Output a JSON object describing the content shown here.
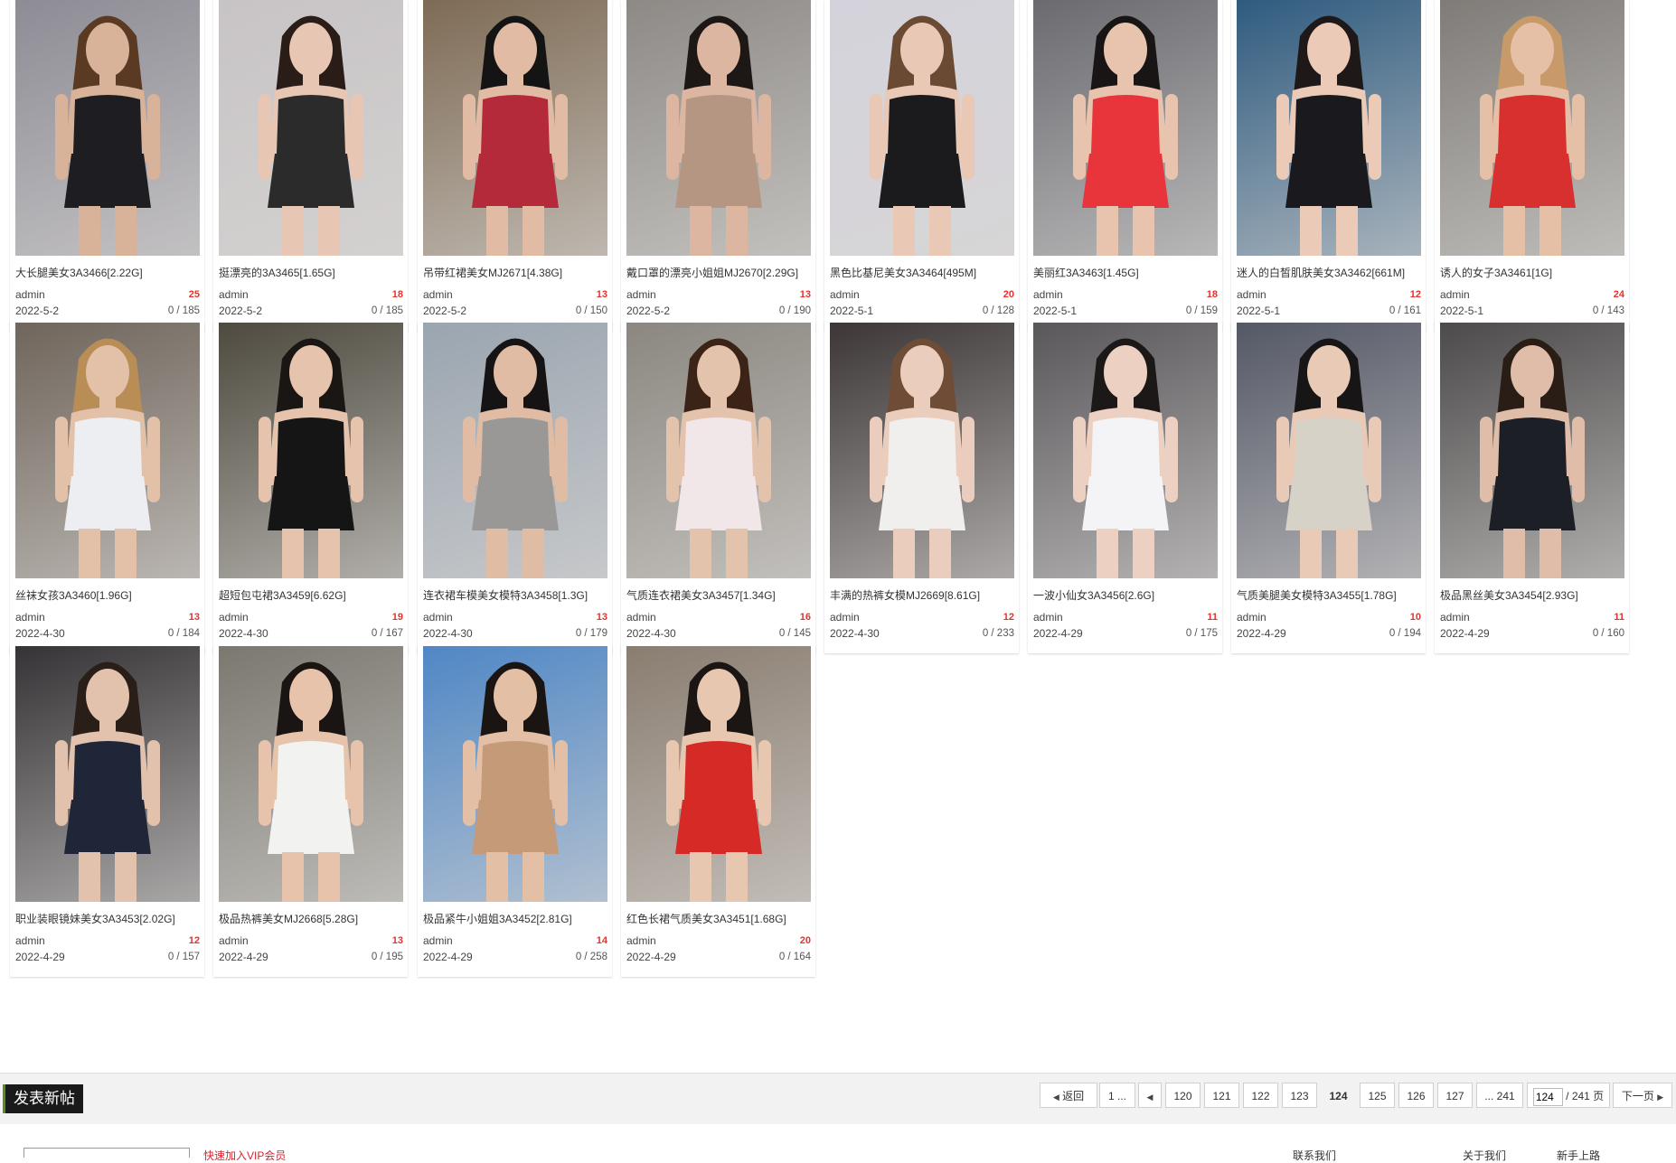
{
  "posts": [
    {
      "title": "大长腿美女3A3466[2.22G]",
      "author": "admin",
      "replies": "25",
      "date": "2022-5-2",
      "views": "0 / 185",
      "bg": "#8d8c95",
      "outfit": "#1e1e22",
      "skin": "#d9b29a",
      "hair": "#5a3a22"
    },
    {
      "title": "挺漂亮的3A3465[1.65G]",
      "author": "admin",
      "replies": "18",
      "date": "2022-5-2",
      "views": "0 / 185",
      "bg": "#c8c4c6",
      "outfit": "#2b2b2b",
      "skin": "#e7c6b3",
      "hair": "#2a1d18"
    },
    {
      "title": "吊带红裙美女MJ2671[4.38G]",
      "author": "admin",
      "replies": "13",
      "date": "2022-5-2",
      "views": "0 / 150",
      "bg": "#7e6b55",
      "outfit": "#b52a3a",
      "skin": "#e2bba4",
      "hair": "#141414"
    },
    {
      "title": "戴口罩的漂亮小姐姐MJ2670[2.29G]",
      "author": "admin",
      "replies": "13",
      "date": "2022-5-2",
      "views": "0 / 190",
      "bg": "#8d8a86",
      "outfit": "#b59683",
      "skin": "#dcb6a0",
      "hair": "#1d1715"
    },
    {
      "title": "黑色比基尼美女3A3464[495M]",
      "author": "admin",
      "replies": "20",
      "date": "2022-5-1",
      "views": "0 / 128",
      "bg": "#d4d3db",
      "outfit": "#1b1b1e",
      "skin": "#e9c8b6",
      "hair": "#6b4a33"
    },
    {
      "title": "美丽红3A3463[1.45G]",
      "author": "admin",
      "replies": "18",
      "date": "2022-5-1",
      "views": "0 / 159",
      "bg": "#6a6a70",
      "outfit": "#e8343b",
      "skin": "#e8c4ae",
      "hair": "#1a1515"
    },
    {
      "title": "迷人的白皙肌肤美女3A3462[661M]",
      "author": "admin",
      "replies": "12",
      "date": "2022-5-1",
      "views": "0 / 161",
      "bg": "#2f5b7f",
      "outfit": "#1a1a1e",
      "skin": "#ebcab8",
      "hair": "#1e1818"
    },
    {
      "title": "诱人的女子3A3461[1G]",
      "author": "admin",
      "replies": "24",
      "date": "2022-5-1",
      "views": "0 / 143",
      "bg": "#7f7c78",
      "outfit": "#d8302e",
      "skin": "#e5c0a6",
      "hair": "#c89a6a"
    },
    {
      "title": "丝袜女孩3A3460[1.96G]",
      "author": "admin",
      "replies": "13",
      "date": "2022-4-30",
      "views": "0 / 184",
      "bg": "#6f655b",
      "outfit": "#eceef2",
      "skin": "#e3c0a8",
      "hair": "#b98d56"
    },
    {
      "title": "超短包屯裙3A3459[6.62G]",
      "author": "admin",
      "replies": "19",
      "date": "2022-4-30",
      "views": "0 / 167",
      "bg": "#4e4a3f",
      "outfit": "#151515",
      "skin": "#e5c3ad",
      "hair": "#1a1614"
    },
    {
      "title": "连衣裙车模美女模特3A3458[1.3G]",
      "author": "admin",
      "replies": "13",
      "date": "2022-4-30",
      "views": "0 / 179",
      "bg": "#9aa5b0",
      "outfit": "#9a9896",
      "skin": "#e0bca5",
      "hair": "#151313"
    },
    {
      "title": "气质连衣裙美女3A3457[1.34G]",
      "author": "admin",
      "replies": "16",
      "date": "2022-4-30",
      "views": "0 / 145",
      "bg": "#8b8780",
      "outfit": "#f1e6e8",
      "skin": "#e4c3ad",
      "hair": "#3b2417"
    },
    {
      "title": "丰满的热裤女模MJ2669[8.61G]",
      "author": "admin",
      "replies": "12",
      "date": "2022-4-30",
      "views": "0 / 233",
      "bg": "#3c3636",
      "outfit": "#f0efee",
      "skin": "#ebcdbd",
      "hair": "#6f4c35"
    },
    {
      "title": "一波小仙女3A3456[2.6G]",
      "author": "admin",
      "replies": "11",
      "date": "2022-4-29",
      "views": "0 / 175",
      "bg": "#59575a",
      "outfit": "#f4f4f6",
      "skin": "#ecd0c1",
      "hair": "#1d1818"
    },
    {
      "title": "气质美腿美女模特3A3455[1.78G]",
      "author": "admin",
      "replies": "10",
      "date": "2022-4-29",
      "views": "0 / 194",
      "bg": "#545866",
      "outfit": "#d7d2c8",
      "skin": "#e9cab6",
      "hair": "#171515"
    },
    {
      "title": "极品黑丝美女3A3454[2.93G]",
      "author": "admin",
      "replies": "11",
      "date": "2022-4-29",
      "views": "0 / 160",
      "bg": "#4c4a4a",
      "outfit": "#1d1f26",
      "skin": "#dfbda8",
      "hair": "#2a1d16"
    },
    {
      "title": "职业装眼镜妹美女3A3453[2.02G]",
      "author": "admin",
      "replies": "12",
      "date": "2022-4-29",
      "views": "0 / 157",
      "bg": "#353335",
      "outfit": "#1f2638",
      "skin": "#e2c2ac",
      "hair": "#2a1e18"
    },
    {
      "title": "极品热裤美女MJ2668[5.28G]",
      "author": "admin",
      "replies": "13",
      "date": "2022-4-29",
      "views": "0 / 195",
      "bg": "#7b7870",
      "outfit": "#f2f2f0",
      "skin": "#e6c3aa",
      "hair": "#1a1512"
    },
    {
      "title": "极品紧牛小姐姐3A3452[2.81G]",
      "author": "admin",
      "replies": "14",
      "date": "2022-4-29",
      "views": "0 / 258",
      "bg": "#4f87c5",
      "outfit": "#c49a78",
      "skin": "#e3bfa6",
      "hair": "#1a1513"
    },
    {
      "title": "红色长裙气质美女3A3451[1.68G]",
      "author": "admin",
      "replies": "20",
      "date": "2022-4-29",
      "views": "0 / 164",
      "bg": "#8a7d70",
      "outfit": "#d52a25",
      "skin": "#e8c7b1",
      "hair": "#1b1614"
    }
  ],
  "new_post_label": "发表新帖",
  "pager": {
    "back": "返回",
    "first": "1 ...",
    "pages": [
      "120",
      "121",
      "122",
      "123",
      "124",
      "125",
      "126",
      "127"
    ],
    "current": "124",
    "last": "... 241",
    "input_value": "124",
    "total": "/ 241 页",
    "next": "下一页"
  },
  "footer": {
    "red_text": "快速加入VIP会员",
    "links": [
      "联系我们",
      "关于我们",
      "新手上路"
    ]
  }
}
